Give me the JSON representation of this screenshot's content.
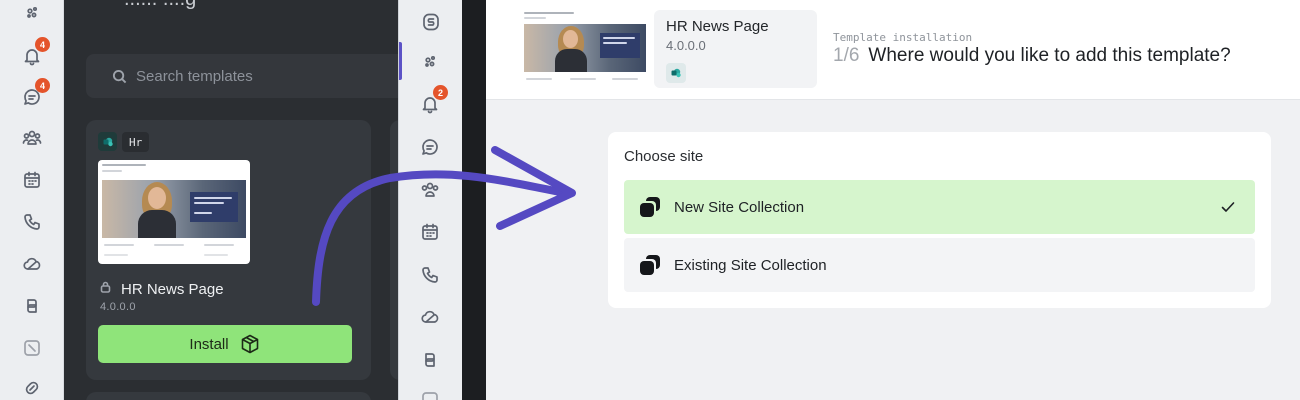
{
  "store": {
    "title_partial": "...... ....g",
    "search_placeholder": "Search templates",
    "card": {
      "category_tag": "Hr",
      "name": "HR News Page",
      "version": "4.0.0.0",
      "install_label": "Install"
    }
  },
  "rail_left": {
    "notifications_badge": "4",
    "chat_badge": "4"
  },
  "rail_middle": {
    "notifications_badge": "2"
  },
  "installer": {
    "template_name": "HR News Page",
    "template_version": "4.0.0.0",
    "step_caption": "Template installation",
    "step_number": "1/6",
    "step_question": "Where would you like to add this template?",
    "choose_label": "Choose site",
    "options": [
      {
        "label": "New Site Collection",
        "selected": true
      },
      {
        "label": "Existing Site Collection",
        "selected": false
      }
    ]
  },
  "colors": {
    "accent_green": "#8fe47a",
    "selected_option": "#d6f5cd",
    "arrow": "#5549c2",
    "badge": "#e4542b"
  }
}
